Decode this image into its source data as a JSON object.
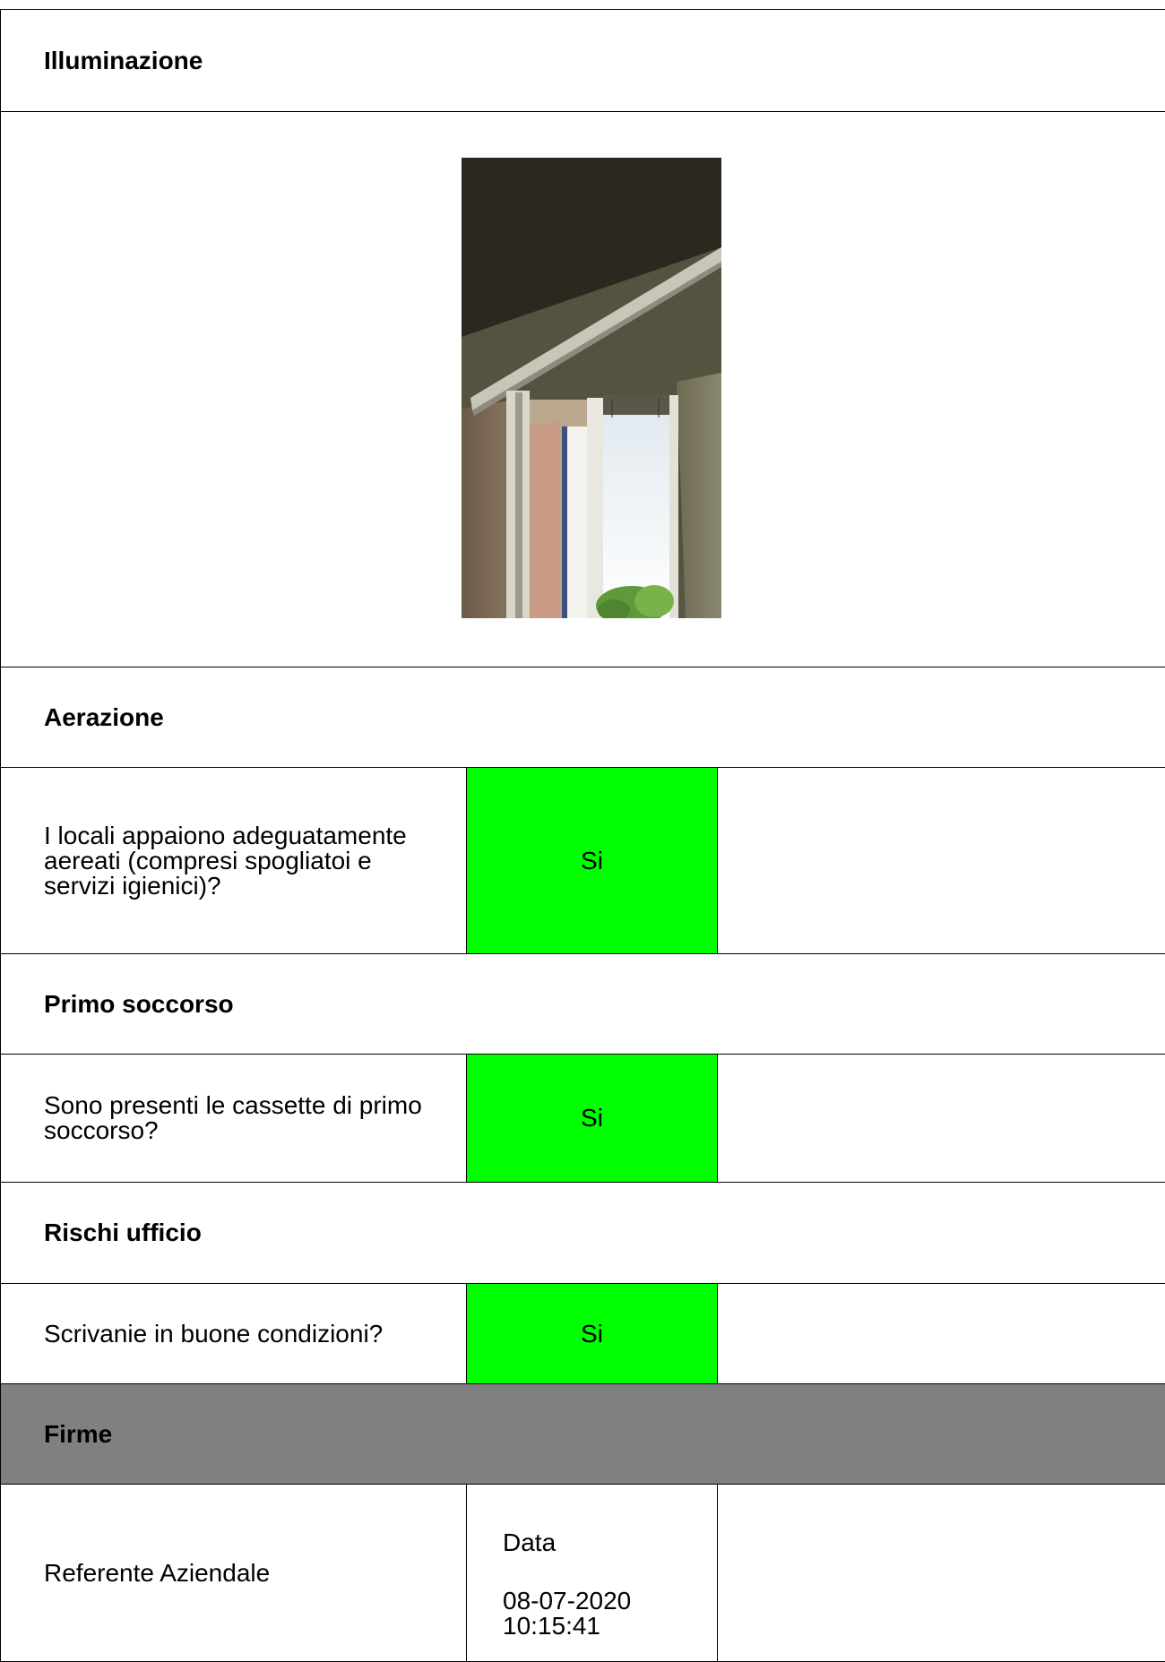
{
  "sections": {
    "illuminazione": {
      "title": "Illuminazione"
    },
    "aerazione": {
      "title": "Aerazione",
      "question": "I locali appaiono adeguatamente aereati (compresi spogliatoi e servizi igienici)?",
      "answer": "Si"
    },
    "primo_soccorso": {
      "title": "Primo soccorso",
      "question": "Sono presenti le cassette di primo soccorso?",
      "answer": "Si"
    },
    "rischi_ufficio": {
      "title": "Rischi ufficio",
      "question": "Scrivanie in buone condizioni?",
      "answer": "Si"
    },
    "firme": {
      "title": "Firme",
      "role": "Referente Aziendale",
      "date_label": "Data",
      "date_value": "08-07-2020 10:15:41"
    }
  },
  "colors": {
    "answer_yes": "#00ff00",
    "section_header_grey": "#808080",
    "border": "#000000"
  }
}
